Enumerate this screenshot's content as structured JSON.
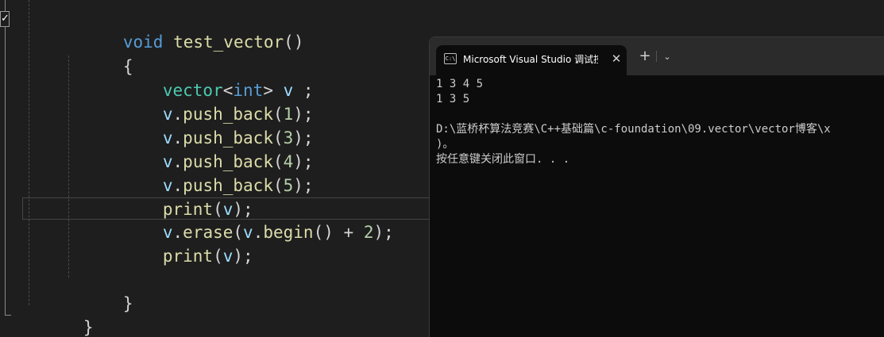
{
  "editor": {
    "fold_marker": "✓",
    "lines": {
      "func_kw": "void",
      "func_name": "test_vector",
      "func_parens": "()",
      "open_brace": "{",
      "decl": {
        "type": "vector",
        "lt": "<",
        "inner": "int",
        "gt": ">",
        "var": "v",
        "semi": " ;"
      },
      "push1": {
        "obj": "v",
        "dot": ".",
        "method": "push_back",
        "open": "(",
        "arg": "1",
        "close": ");"
      },
      "push2": {
        "obj": "v",
        "dot": ".",
        "method": "push_back",
        "open": "(",
        "arg": "3",
        "close": ");"
      },
      "push3": {
        "obj": "v",
        "dot": ".",
        "method": "push_back",
        "open": "(",
        "arg": "4",
        "close": ");"
      },
      "push4": {
        "obj": "v",
        "dot": ".",
        "method": "push_back",
        "open": "(",
        "arg": "5",
        "close": ");"
      },
      "print1": {
        "fn": "print",
        "open": "(",
        "arg": "v",
        "close": ");"
      },
      "erase": {
        "obj": "v",
        "dot": ".",
        "method": "erase",
        "open": "(",
        "obj2": "v",
        "dot2": ".",
        "method2": "begin",
        "parens2": "()",
        "plus": " + ",
        "num": "2",
        "close": ");"
      },
      "print2": {
        "fn": "print",
        "open": "(",
        "arg": "v",
        "close": ");"
      },
      "close_brace_inner": "}",
      "close_brace_outer": "}"
    },
    "colors": {
      "keyword": "#569cd6",
      "function": "#dcdcaa",
      "type": "#4ec9b0",
      "variable": "#9cdcfe",
      "number": "#b5cea8",
      "background": "#1e1e1e"
    }
  },
  "console": {
    "icon": "terminal-icon",
    "icon_text": "C:\\",
    "tab_title": "Microsoft Visual Studio 调试控",
    "close_glyph": "✕",
    "new_tab_glyph": "+",
    "dropdown_glyph": "⌄",
    "output": [
      "1 3 4 5",
      "1 3 5",
      "",
      "D:\\蓝桥杯算法竞赛\\C++基础篇\\c-foundation\\09.vector\\vector博客\\x",
      ")。",
      "按任意键关闭此窗口. . ."
    ]
  }
}
